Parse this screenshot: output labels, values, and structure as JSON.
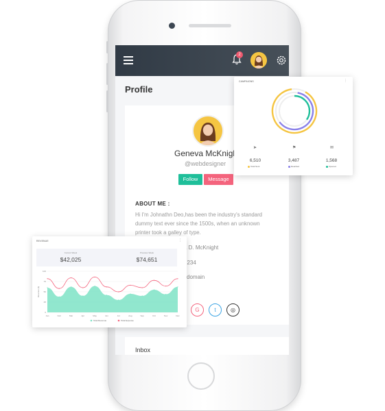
{
  "topbar": {
    "notifications_count": "2"
  },
  "page": {
    "title": "Profile"
  },
  "profile": {
    "name": "Geneva McKnight",
    "handle": "@webdesigner",
    "follow_label": "Follow",
    "message_label": "Message",
    "about_title": "ABOUT ME :",
    "about_text": "Hi I'm Johnathn Deo,has been the industry's standard dummy text ever since the 1500s, when an unknown printer took a galley of type.",
    "info_name": "a D. McKnight",
    "info_phone": "1234",
    "info_email": "l.domain",
    "social": [
      {
        "icon": "google-plus-icon",
        "glyph": "G",
        "color": "#f4647d"
      },
      {
        "icon": "twitter-icon",
        "glyph": "t",
        "color": "#3aa3e3"
      },
      {
        "icon": "github-icon",
        "glyph": "◎",
        "color": "#333333"
      }
    ]
  },
  "inbox": {
    "title": "Inbox"
  },
  "campaigns": {
    "title": "CAMPAIGNS",
    "menu": "⋮",
    "stats": [
      {
        "value": "6,510",
        "label": "Total Sent",
        "color": "#f5c542"
      },
      {
        "value": "3,487",
        "label": "Reached",
        "color": "#8a80e8"
      },
      {
        "value": "1,568",
        "label": "Opened",
        "color": "#1fbf9a"
      }
    ]
  },
  "revenue": {
    "title": "REVENUE",
    "menu": "⋮",
    "current_week_label": "Current Week",
    "current_week_value": "$42,025",
    "previous_week_label": "Previous Week",
    "previous_week_value": "$74,651",
    "ylabel": "Revenue ($)",
    "legend": [
      "Total Revenue",
      "Total Expense"
    ]
  },
  "chart_data": {
    "type": "area",
    "categories": [
      "Jan",
      "Feb",
      "Mar",
      "Apr",
      "May",
      "Jun",
      "Jul",
      "Aug",
      "Sep",
      "Oct",
      "Nov",
      "Dec"
    ],
    "series": [
      {
        "name": "Total Revenue",
        "color": "#7ee3c6",
        "values": [
          60,
          38,
          62,
          40,
          64,
          42,
          30,
          45,
          40,
          55,
          44,
          62
        ]
      },
      {
        "name": "Total Expense",
        "color": "#f4647d",
        "values": [
          82,
          58,
          84,
          60,
          86,
          62,
          50,
          66,
          60,
          78,
          64,
          82
        ]
      }
    ],
    "ylim": [
      0,
      100
    ],
    "grid": true,
    "legend": "bottom"
  }
}
